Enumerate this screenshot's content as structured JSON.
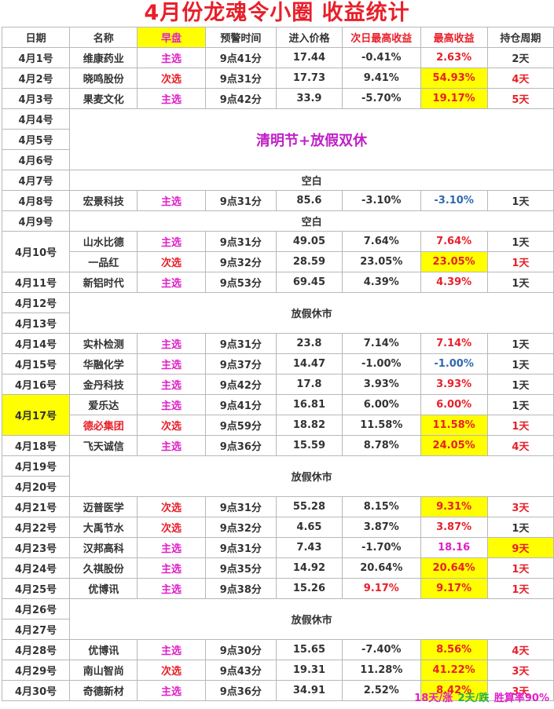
{
  "title": "4月份龙魂令小圈  收益统计",
  "headers": [
    "日期",
    "名称",
    "早盘",
    "预警时间",
    "进入价格",
    "次日最高收益",
    "最高收益",
    "持仓周期"
  ],
  "rows": [
    {
      "date": "4月1号",
      "name": "维康药业",
      "pick": "主选",
      "time": "9点41分",
      "price": "17.44",
      "next": "-0.41%",
      "max": "2.63%",
      "hold": "2天"
    },
    {
      "date": "4月2号",
      "name": "晓鸣股份",
      "pick": "次选",
      "time": "9点31分",
      "price": "17.73",
      "next": "9.41%",
      "max": "54.93%",
      "hold": "4天"
    },
    {
      "date": "4月3号",
      "name": "果麦文化",
      "pick": "主选",
      "time": "9点42分",
      "price": "33.9",
      "next": "-5.70%",
      "max": "19.17%",
      "hold": "5天"
    },
    {
      "date": "4月4号"
    },
    {
      "date": "4月5号"
    },
    {
      "date": "4月6号"
    },
    {
      "date": "4月7号"
    },
    {
      "date": "4月8号",
      "name": "宏景科技",
      "pick": "主选",
      "time": "9点31分",
      "price": "85.6",
      "next": "-3.10%",
      "max": "-3.10%",
      "hold": "1天"
    },
    {
      "date": "4月9号"
    },
    {
      "date": "4月10号",
      "name": "山水比德",
      "pick": "主选",
      "time": "9点31分",
      "price": "49.05",
      "next": "7.64%",
      "max": "7.64%",
      "hold": "1天"
    },
    {
      "name": "一品红",
      "pick": "次选",
      "time": "9点32分",
      "price": "28.59",
      "next": "23.05%",
      "max": "23.05%",
      "hold": "1天"
    },
    {
      "date": "4月11号",
      "name": "新铝时代",
      "pick": "主选",
      "time": "9点53分",
      "price": "69.45",
      "next": "4.39%",
      "max": "4.39%",
      "hold": "1天"
    },
    {
      "date": "4月12号"
    },
    {
      "date": "4月13号"
    },
    {
      "date": "4月14号",
      "name": "实朴检测",
      "pick": "主选",
      "time": "9点31分",
      "price": "23.8",
      "next": "7.14%",
      "max": "7.14%",
      "hold": "1天"
    },
    {
      "date": "4月15号",
      "name": "华融化学",
      "pick": "主选",
      "time": "9点37分",
      "price": "14.47",
      "next": "-1.00%",
      "max": "-1.00%",
      "hold": "1天"
    },
    {
      "date": "4月16号",
      "name": "金丹科技",
      "pick": "主选",
      "time": "9点42分",
      "price": "17.8",
      "next": "3.93%",
      "max": "3.93%",
      "hold": "1天"
    },
    {
      "date": "4月17号",
      "name": "爱乐达",
      "pick": "主选",
      "time": "9点41分",
      "price": "16.81",
      "next": "6.00%",
      "max": "6.00%",
      "hold": "1天"
    },
    {
      "name": "德必集团",
      "pick": "次选",
      "time": "9点59分",
      "price": "18.82",
      "next": "11.58%",
      "max": "11.58%",
      "hold": "1天"
    },
    {
      "date": "4月18号",
      "name": "飞天诚信",
      "pick": "主选",
      "time": "9点36分",
      "price": "15.59",
      "next": "8.78%",
      "max": "24.05%",
      "hold": "4天"
    },
    {
      "date": "4月19号"
    },
    {
      "date": "4月20号"
    },
    {
      "date": "4月21号",
      "name": "迈普医学",
      "pick": "次选",
      "time": "9点31分",
      "price": "55.28",
      "next": "8.15%",
      "max": "9.31%",
      "hold": "3天"
    },
    {
      "date": "4月22号",
      "name": "大禹节水",
      "pick": "次选",
      "time": "9点32分",
      "price": "4.65",
      "next": "3.87%",
      "max": "3.87%",
      "hold": "1天"
    },
    {
      "date": "4月23号",
      "name": "汉邦高科",
      "pick": "主选",
      "time": "9点31分",
      "price": "7.43",
      "next": "-1.70%",
      "max": "18.16",
      "hold": "9天"
    },
    {
      "date": "4月24号",
      "name": "久祺股份",
      "pick": "主选",
      "time": "9点35分",
      "price": "14.92",
      "next": "20.64%",
      "max": "20.64%",
      "hold": "1天"
    },
    {
      "date": "4月25号",
      "name": "优博讯",
      "pick": "主选",
      "time": "9点38分",
      "price": "15.26",
      "next": "9.17%",
      "max": "9.17%",
      "hold": "1天"
    },
    {
      "date": "4月26号"
    },
    {
      "date": "4月27号"
    },
    {
      "date": "4月28号",
      "name": "优博讯",
      "pick": "主选",
      "time": "9点30分",
      "price": "15.65",
      "next": "-7.40%",
      "max": "8.56%",
      "hold": "4天"
    },
    {
      "date": "4月29号",
      "name": "南山智尚",
      "pick": "次选",
      "time": "9点43分",
      "price": "19.31",
      "next": "11.28%",
      "max": "41.22%",
      "hold": "3天"
    },
    {
      "date": "4月30号",
      "name": "奇德新材",
      "pick": "主选",
      "time": "9点36分",
      "price": "34.91",
      "next": "2.52%",
      "max": "8.42%",
      "hold": "3天"
    }
  ],
  "notes": {
    "qingming": "清明节+放假双休",
    "blank": "空白",
    "weekend": "放假休市"
  },
  "footer": {
    "up": "18天/涨",
    "down": "2天/跌",
    "winrate": "胜算率90%"
  },
  "colors": {
    "title": "#e8202a",
    "highlight": "#ffff00",
    "primary_pick": "#e020c8",
    "secondary_pick": "#e8202a",
    "negative": "#3068b0",
    "holiday": "#c020c8",
    "down": "#20b050"
  }
}
